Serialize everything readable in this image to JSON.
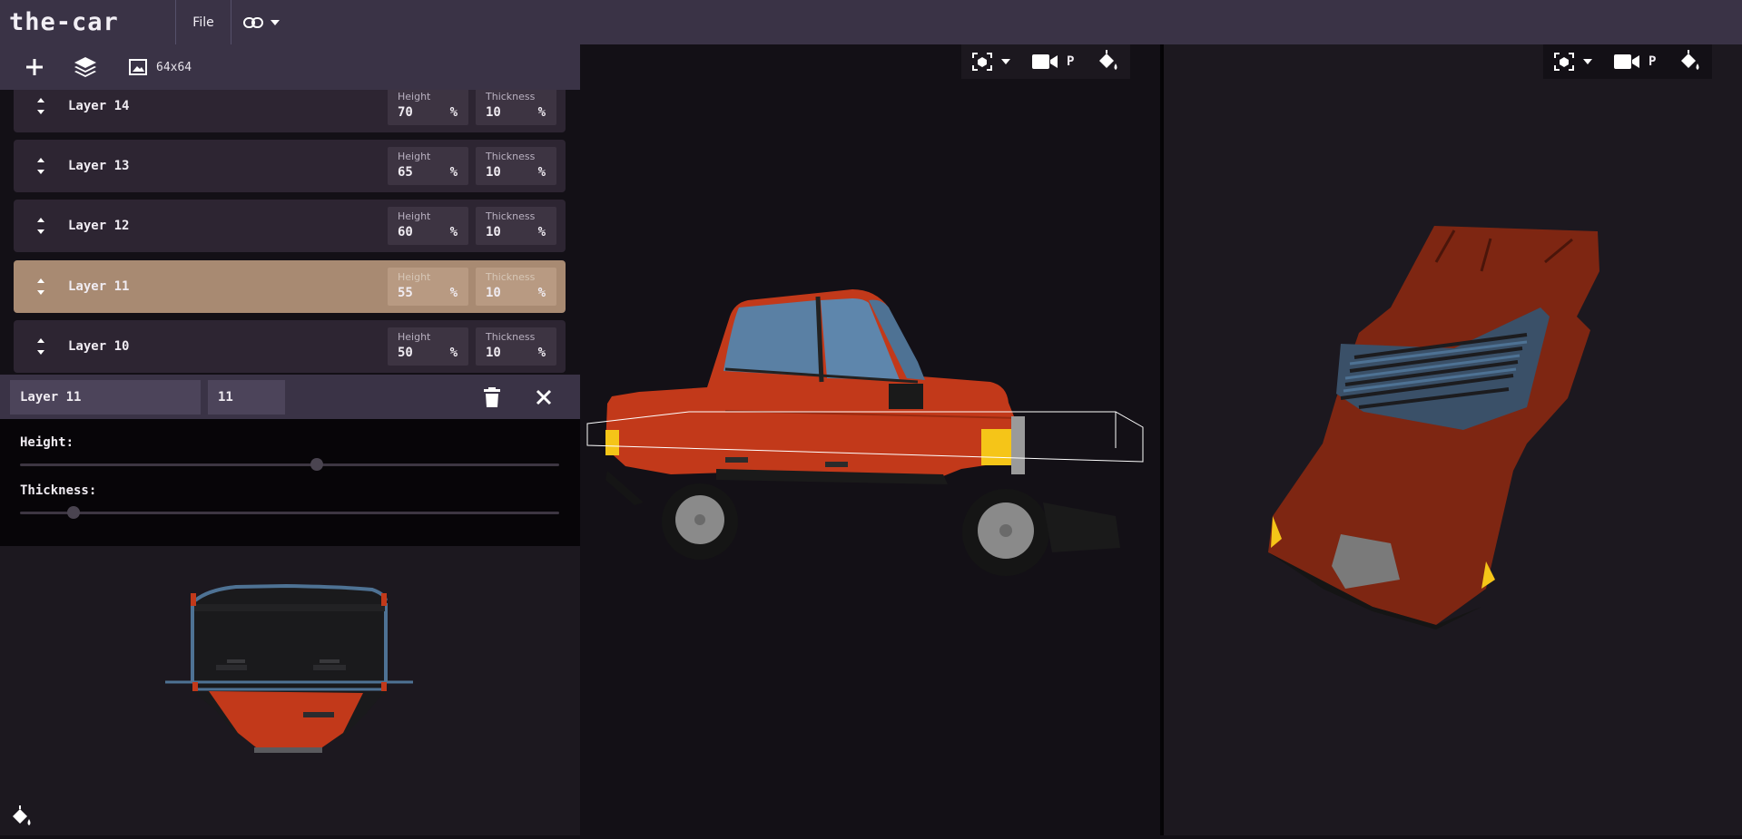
{
  "app": {
    "title": "the-car"
  },
  "menu": {
    "file_label": "File",
    "link_icon": "link-icon",
    "dropdown_icon": "chevron-down-icon"
  },
  "toolbar": {
    "add_icon": "plus-icon",
    "layers_icon": "layers-icon",
    "image_icon": "image-icon",
    "canvas_size": "64x64"
  },
  "layers": [
    {
      "name": "Layer 14",
      "height_label": "Height",
      "height": "70",
      "thickness_label": "Thickness",
      "thickness": "10",
      "unit": "%",
      "selected": false
    },
    {
      "name": "Layer 13",
      "height_label": "Height",
      "height": "65",
      "thickness_label": "Thickness",
      "thickness": "10",
      "unit": "%",
      "selected": false
    },
    {
      "name": "Layer 12",
      "height_label": "Height",
      "height": "60",
      "thickness_label": "Thickness",
      "thickness": "10",
      "unit": "%",
      "selected": false
    },
    {
      "name": "Layer 11",
      "height_label": "Height",
      "height": "55",
      "thickness_label": "Thickness",
      "thickness": "10",
      "unit": "%",
      "selected": true
    },
    {
      "name": "Layer 10",
      "height_label": "Height",
      "height": "50",
      "thickness_label": "Thickness",
      "thickness": "10",
      "unit": "%",
      "selected": false
    }
  ],
  "editor": {
    "name_value": "Layer 11",
    "index_value": "11",
    "delete_icon": "trash-icon",
    "close_icon": "close-icon",
    "height_label": "Height:",
    "height_level": 0.55,
    "thickness_label": "Thickness:",
    "thickness_level": 0.1
  },
  "viewports": [
    {
      "camera_icon": "focus-camera-icon",
      "video_icon": "video-camera-icon",
      "projection": "P",
      "paint_icon": "paint-bucket-icon"
    },
    {
      "camera_icon": "focus-camera-icon",
      "video_icon": "video-camera-icon",
      "projection": "P",
      "paint_icon": "paint-bucket-icon"
    }
  ],
  "preview": {
    "paint_icon": "paint-bucket-icon"
  },
  "colors": {
    "car_body": "#c2391a",
    "window": "#4e7294",
    "selected_layer": "#a88a72",
    "topbar": "#3a3346",
    "headlight": "#f5c518"
  }
}
